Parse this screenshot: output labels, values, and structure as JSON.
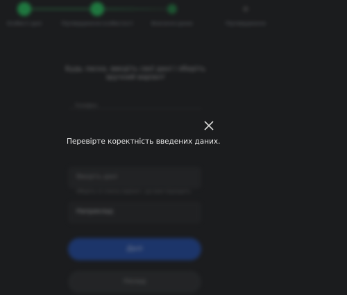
{
  "stepper": {
    "steps": [
      {
        "label": "Особисті дані"
      },
      {
        "label": "Підтвердження особистості"
      },
      {
        "label": "Внесення даних"
      },
      {
        "label": "Підтвердження"
      }
    ]
  },
  "form": {
    "prompt": "Будь ласка, введіть свої дані і оберіть зручний варіант",
    "field_label": "Телефон",
    "input_placeholder": "Введіть дані",
    "hint": "Оберіть зі списку варіант, що вам підходить",
    "select_value": "Наприклад"
  },
  "buttons": {
    "primary": "Далі",
    "secondary": "Назад"
  },
  "modal": {
    "message": "Перевірте коректність введених даних."
  },
  "colors": {
    "background": "#1b1c1e",
    "accent_green": "#23c25b",
    "primary_blue": "#1e4aa8"
  }
}
